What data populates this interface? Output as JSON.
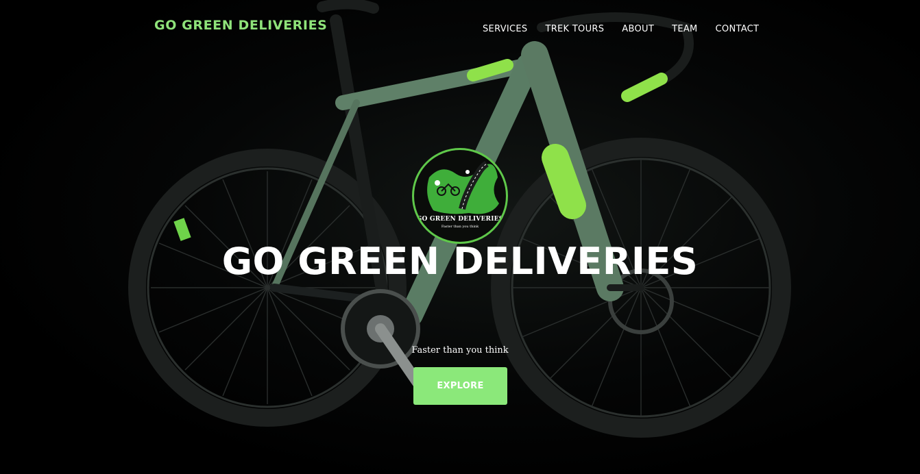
{
  "header": {
    "brand": "GO GREEN DELIVERIES",
    "nav": [
      {
        "label": "SERVICES"
      },
      {
        "label": "TREK TOURS"
      },
      {
        "label": "ABOUT"
      },
      {
        "label": "TEAM"
      },
      {
        "label": "CONTACT"
      }
    ]
  },
  "hero": {
    "logo": {
      "name": "GO GREEN DELIVERIES",
      "tagline": "Faster than you think"
    },
    "title": "GO GREEN DELIVERIES",
    "tagline": "Faster than you think",
    "cta_label": "EXPLORE"
  },
  "colors": {
    "accent": "#8be87a",
    "brand_text": "#8fe37a",
    "background": "#000000"
  }
}
